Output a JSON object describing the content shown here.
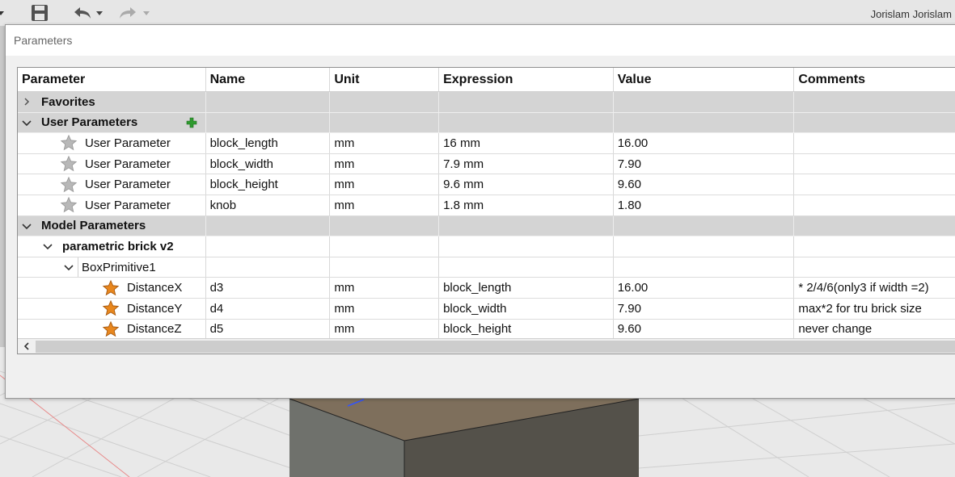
{
  "app": {
    "user_name": "Jorislam Jorislam"
  },
  "toolbar_icons": [
    "save-icon",
    "undo-icon",
    "dropdown-icon",
    "redo-icon",
    "dropdown-icon"
  ],
  "dialog": {
    "title": "Parameters"
  },
  "table": {
    "headers": [
      "Parameter",
      "Name",
      "Unit",
      "Expression",
      "Value",
      "Comments"
    ],
    "favorites": {
      "label": "Favorites",
      "expanded": false
    },
    "user_parameters": {
      "label": "User Parameters",
      "expanded": true,
      "rows": [
        {
          "type": "User Parameter",
          "name": "block_length",
          "unit": "mm",
          "expression": "16 mm",
          "value": "16.00",
          "comment": ""
        },
        {
          "type": "User Parameter",
          "name": "block_width",
          "unit": "mm",
          "expression": "7.9 mm",
          "value": "7.90",
          "comment": ""
        },
        {
          "type": "User Parameter",
          "name": "block_height",
          "unit": "mm",
          "expression": "9.6 mm",
          "value": "9.60",
          "comment": ""
        },
        {
          "type": "User Parameter",
          "name": "knob",
          "unit": "mm",
          "expression": "1.8 mm",
          "value": "1.80",
          "comment": ""
        }
      ]
    },
    "model_parameters": {
      "label": "Model Parameters",
      "expanded": true,
      "component": "parametric brick v2",
      "feature": "BoxPrimitive1",
      "rows": [
        {
          "type": "DistanceX",
          "name": "d3",
          "unit": "mm",
          "expression": "block_length",
          "value": "16.00",
          "comment": "* 2/4/6(only3 if width =2)"
        },
        {
          "type": "DistanceY",
          "name": "d4",
          "unit": "mm",
          "expression": "block_width",
          "value": "7.90",
          "comment": "max*2 for tru brick size"
        },
        {
          "type": "DistanceZ",
          "name": "d5",
          "unit": "mm",
          "expression": "block_height",
          "value": "9.60",
          "comment": "never change"
        }
      ]
    }
  },
  "colors": {
    "group_row_bg": "#d4d4d4",
    "star_gray": "#a8a8a8",
    "star_orange": "#e8871e",
    "add_green": "#2e9a2e"
  }
}
